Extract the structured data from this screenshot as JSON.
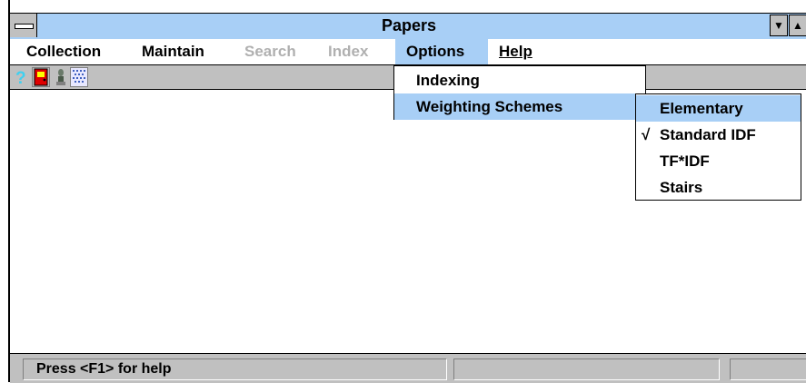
{
  "window": {
    "title": "Papers"
  },
  "menubar": {
    "items": [
      {
        "label": "Collection"
      },
      {
        "label": "Maintain"
      },
      {
        "label": "Search"
      },
      {
        "label": "Index"
      },
      {
        "label": "Options"
      },
      {
        "label": "Help"
      }
    ]
  },
  "options_menu": {
    "items": [
      {
        "label": "Indexing"
      },
      {
        "label": "Weighting Schemes"
      }
    ]
  },
  "weighting_submenu": {
    "items": [
      {
        "label": "Elementary",
        "checked": false
      },
      {
        "label": "Standard IDF",
        "checked": true
      },
      {
        "label": "TF*IDF",
        "checked": false
      },
      {
        "label": "Stairs",
        "checked": false
      }
    ],
    "check_glyph": "√"
  },
  "statusbar": {
    "help_text": "Press <F1> for help"
  },
  "colors": {
    "highlight": "#a8cff6",
    "panel": "#c0c0c0",
    "disabled": "#b0b0b0"
  },
  "icons": [
    "help-question-icon",
    "exit-door-icon",
    "figure-icon",
    "dotted-grid-icon",
    "system-menu-icon",
    "minimize-arrow-icon",
    "maximize-arrow-icon"
  ]
}
